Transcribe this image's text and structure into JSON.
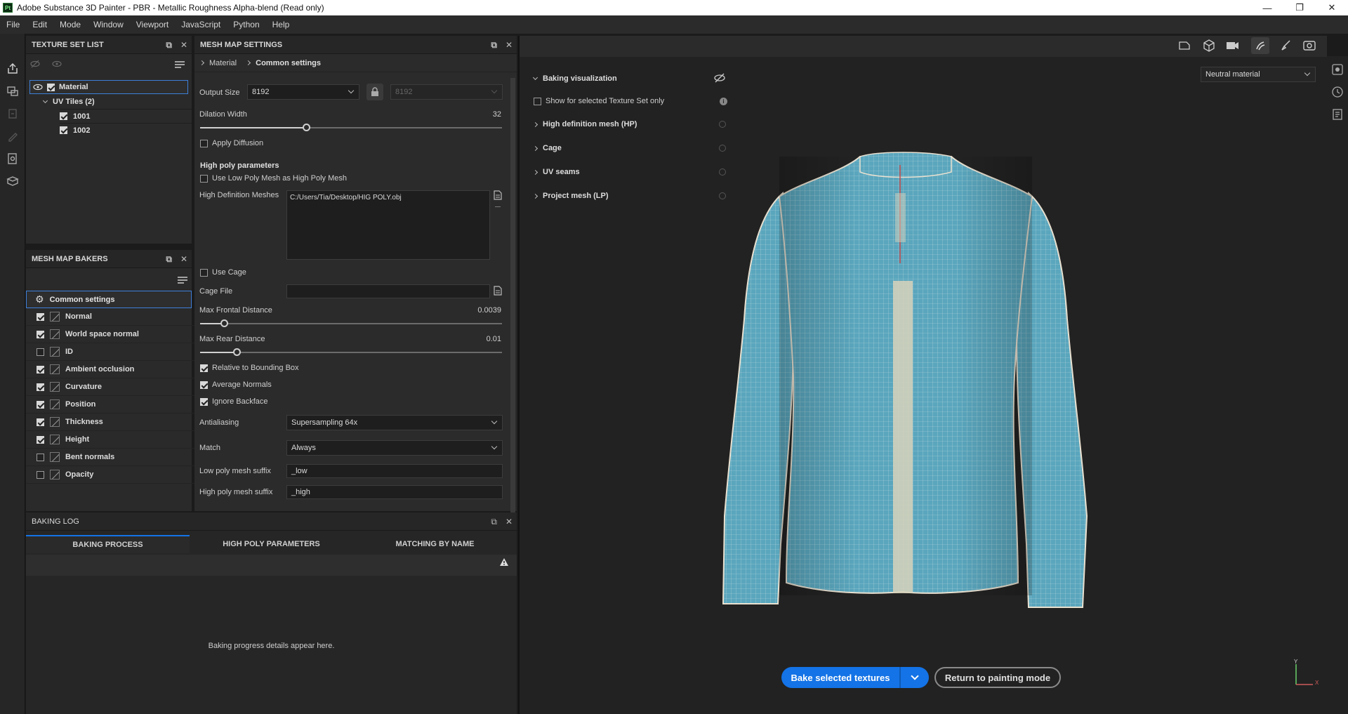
{
  "window": {
    "logo": "Pt",
    "title": "Adobe Substance 3D Painter - PBR - Metallic Roughness Alpha-blend (Read only)",
    "minimize": "—",
    "restore": "❐",
    "close": "✕"
  },
  "menu": [
    "File",
    "Edit",
    "Mode",
    "Window",
    "Viewport",
    "JavaScript",
    "Python",
    "Help"
  ],
  "texture_set_list": {
    "title": "TEXTURE SET LIST",
    "rows": [
      {
        "label": "Material",
        "checked": true
      },
      {
        "label": "UV Tiles (2)"
      },
      {
        "label": "1001",
        "checked": true
      },
      {
        "label": "1002",
        "checked": true
      }
    ]
  },
  "mesh_map_bakers": {
    "title": "MESH MAP BAKERS",
    "common": "Common settings",
    "items": [
      {
        "label": "Normal",
        "checked": true
      },
      {
        "label": "World space normal",
        "checked": true
      },
      {
        "label": "ID",
        "checked": false
      },
      {
        "label": "Ambient occlusion",
        "checked": true
      },
      {
        "label": "Curvature",
        "checked": true
      },
      {
        "label": "Position",
        "checked": true
      },
      {
        "label": "Thickness",
        "checked": true
      },
      {
        "label": "Height",
        "checked": true
      },
      {
        "label": "Bent normals",
        "checked": false
      },
      {
        "label": "Opacity",
        "checked": false
      }
    ]
  },
  "mesh_map_settings": {
    "title": "MESH MAP SETTINGS",
    "breadcrumb": [
      "Material",
      "Common settings"
    ],
    "output_size_label": "Output Size",
    "output_size": "8192",
    "output_size_locked": "8192",
    "dilation_label": "Dilation Width",
    "dilation_value": "32",
    "dilation_fraction": 0.35,
    "apply_diffusion": "Apply Diffusion",
    "high_poly_header": "High poly parameters",
    "use_low_poly": "Use Low Poly Mesh as High Poly Mesh",
    "hd_meshes_label": "High Definition Meshes",
    "hd_meshes_value": "C:/Users/Tia/Desktop/HIG POLY.obj",
    "use_cage": "Use Cage",
    "cage_file_label": "Cage File",
    "max_frontal_label": "Max Frontal Distance",
    "max_frontal_value": "0.0039",
    "max_frontal_fraction": 0.08,
    "max_rear_label": "Max Rear Distance",
    "max_rear_value": "0.01",
    "max_rear_fraction": 0.12,
    "relative_bbox": "Relative to Bounding Box",
    "average_normals": "Average Normals",
    "ignore_backface": "Ignore Backface",
    "antialiasing_label": "Antialiasing",
    "antialiasing_value": "Supersampling 64x",
    "match_label": "Match",
    "match_value": "Always",
    "low_suffix_label": "Low poly mesh suffix",
    "low_suffix_value": "_low",
    "high_suffix_label": "High poly mesh suffix",
    "high_suffix_value": "_high"
  },
  "baking_visualization": {
    "title": "Baking visualization",
    "show_selected": "Show for selected Texture Set only",
    "sections": [
      "High definition mesh (HP)",
      "Cage",
      "UV seams",
      "Project mesh (LP)"
    ]
  },
  "viewport": {
    "material_dropdown": "Neutral material",
    "bake_button": "Bake selected textures",
    "return_button": "Return to painting mode",
    "axis_y": "Y",
    "axis_x": "X",
    "mesh_color": "#5aa6bd",
    "wire_color": "#e8e0d0"
  },
  "baking_log": {
    "title": "BAKING LOG",
    "tabs": [
      "BAKING PROCESS",
      "HIGH POLY PARAMETERS",
      "MATCHING BY NAME"
    ],
    "placeholder": "Baking progress details appear here."
  },
  "colors": {
    "accent": "#1473e6",
    "panel": "#2a2a2a",
    "viewport": "#222222"
  }
}
